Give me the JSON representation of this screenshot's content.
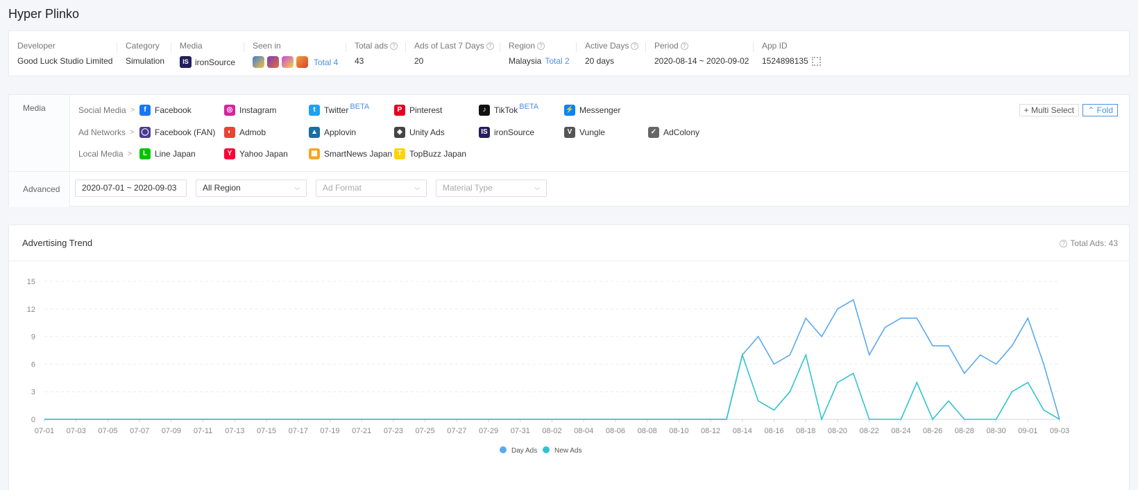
{
  "page": {
    "title": "Hyper Plinko"
  },
  "info": {
    "developer": {
      "label": "Developer",
      "value": "Good Luck Studio Limited"
    },
    "category": {
      "label": "Category",
      "value": "Simulation"
    },
    "media": {
      "label": "Media",
      "value": "ironSource",
      "logo": "IS"
    },
    "seen_in": {
      "label": "Seen in",
      "total": "Total 4",
      "apps": [
        "#3d7bd9",
        "#7b3fb8",
        "#c54bd6",
        "#f0a23a"
      ]
    },
    "total_ads": {
      "label": "Total ads",
      "value": "43"
    },
    "ads_last7": {
      "label": "Ads of Last 7 Days",
      "value": "20"
    },
    "region": {
      "label": "Region",
      "value": "Malaysia",
      "total": "Total 2"
    },
    "active_days": {
      "label": "Active Days",
      "value": "20 days"
    },
    "period": {
      "label": "Period",
      "value": "2020-08-14 ~ 2020-09-02"
    },
    "app_id": {
      "label": "App ID",
      "value": "1524898135"
    }
  },
  "filter": {
    "media_label": "Media",
    "advanced_label": "Advanced",
    "rows": {
      "social": "Social Media",
      "ad_networks": "Ad Networks",
      "local": "Local Media"
    },
    "social_items": [
      {
        "label": "Facebook",
        "icon": "facebook-icon",
        "color": "#1877f2",
        "glyph": "f"
      },
      {
        "label": "Instagram",
        "icon": "instagram-icon",
        "color": "#d6249f",
        "glyph": "◎"
      },
      {
        "label": "Twitter",
        "icon": "twitter-icon",
        "color": "#1da1f2",
        "glyph": "t",
        "badge": "BETA"
      },
      {
        "label": "Pinterest",
        "icon": "pinterest-icon",
        "color": "#e60023",
        "glyph": "P"
      },
      {
        "label": "TikTok",
        "icon": "tiktok-icon",
        "color": "#111111",
        "glyph": "♪",
        "badge": "BETA"
      },
      {
        "label": "Messenger",
        "icon": "messenger-icon",
        "color": "#0084ff",
        "glyph": "⚡"
      }
    ],
    "ad_network_items": [
      {
        "label": "Facebook (FAN)",
        "icon": "facebook-fan-icon",
        "color": "#4b3a8f",
        "glyph": "◯"
      },
      {
        "label": "Admob",
        "icon": "admob-icon",
        "color": "#ea4335",
        "glyph": "◐"
      },
      {
        "label": "Applovin",
        "icon": "applovin-icon",
        "color": "#1a6fa3",
        "glyph": "▲"
      },
      {
        "label": "Unity Ads",
        "icon": "unity-icon",
        "color": "#444444",
        "glyph": "◈"
      },
      {
        "label": "ironSource",
        "icon": "ironsource-icon",
        "color": "#231f5c",
        "glyph": "IS"
      },
      {
        "label": "Vungle",
        "icon": "vungle-icon",
        "color": "#555555",
        "glyph": "V"
      },
      {
        "label": "AdColony",
        "icon": "adcolony-icon",
        "color": "#666666",
        "glyph": "✓"
      }
    ],
    "local_items": [
      {
        "label": "Line Japan",
        "icon": "line-icon",
        "color": "#00c300",
        "glyph": "L"
      },
      {
        "label": "Yahoo Japan",
        "icon": "yahoo-japan-icon",
        "color": "#ff0033",
        "glyph": "Y"
      },
      {
        "label": "SmartNews Japan",
        "icon": "smartnews-icon",
        "color": "#f5a623",
        "glyph": "▦"
      },
      {
        "label": "TopBuzz Japan",
        "icon": "topbuzz-icon",
        "color": "#ffd400",
        "glyph": "T"
      }
    ],
    "multi_select": "Multi Select",
    "fold": "Fold",
    "date_range": "2020-07-01 ~ 2020-09-03",
    "region_select": "All Region",
    "ad_format_placeholder": "Ad Format",
    "material_type_placeholder": "Material Type"
  },
  "trend": {
    "title": "Advertising Trend",
    "total": "Total Ads: 43"
  },
  "chart_data": {
    "type": "line",
    "ylim": [
      0,
      15
    ],
    "yticks": [
      0,
      3,
      6,
      9,
      12,
      15
    ],
    "x": [
      "07-01",
      "07-02",
      "07-03",
      "07-04",
      "07-05",
      "07-06",
      "07-07",
      "07-08",
      "07-09",
      "07-10",
      "07-11",
      "07-12",
      "07-13",
      "07-14",
      "07-15",
      "07-16",
      "07-17",
      "07-18",
      "07-19",
      "07-20",
      "07-21",
      "07-22",
      "07-23",
      "07-24",
      "07-25",
      "07-26",
      "07-27",
      "07-28",
      "07-29",
      "07-30",
      "07-31",
      "08-01",
      "08-02",
      "08-03",
      "08-04",
      "08-05",
      "08-06",
      "08-07",
      "08-08",
      "08-09",
      "08-10",
      "08-11",
      "08-12",
      "08-13",
      "08-14",
      "08-15",
      "08-16",
      "08-17",
      "08-18",
      "08-19",
      "08-20",
      "08-21",
      "08-22",
      "08-23",
      "08-24",
      "08-25",
      "08-26",
      "08-27",
      "08-28",
      "08-29",
      "08-30",
      "08-31",
      "09-01",
      "09-02",
      "09-03"
    ],
    "xtick_labels": [
      "07-01",
      "07-03",
      "07-05",
      "07-07",
      "07-09",
      "07-11",
      "07-13",
      "07-15",
      "07-17",
      "07-19",
      "07-21",
      "07-23",
      "07-25",
      "07-27",
      "07-29",
      "07-31",
      "08-02",
      "08-04",
      "08-06",
      "08-08",
      "08-10",
      "08-12",
      "08-14",
      "08-16",
      "08-18",
      "08-20",
      "08-22",
      "08-24",
      "08-26",
      "08-28",
      "08-30",
      "09-01",
      "09-03"
    ],
    "series": [
      {
        "name": "Day Ads",
        "color": "#5aa9f0",
        "values": [
          0,
          0,
          0,
          0,
          0,
          0,
          0,
          0,
          0,
          0,
          0,
          0,
          0,
          0,
          0,
          0,
          0,
          0,
          0,
          0,
          0,
          0,
          0,
          0,
          0,
          0,
          0,
          0,
          0,
          0,
          0,
          0,
          0,
          0,
          0,
          0,
          0,
          0,
          0,
          0,
          0,
          0,
          0,
          0,
          7,
          9,
          6,
          7,
          11,
          9,
          12,
          13,
          7,
          10,
          11,
          11,
          8,
          8,
          5,
          7,
          6,
          8,
          11,
          6,
          0
        ]
      },
      {
        "name": "New Ads",
        "color": "#2ec4cf",
        "values": [
          0,
          0,
          0,
          0,
          0,
          0,
          0,
          0,
          0,
          0,
          0,
          0,
          0,
          0,
          0,
          0,
          0,
          0,
          0,
          0,
          0,
          0,
          0,
          0,
          0,
          0,
          0,
          0,
          0,
          0,
          0,
          0,
          0,
          0,
          0,
          0,
          0,
          0,
          0,
          0,
          0,
          0,
          0,
          0,
          7,
          2,
          1,
          3,
          7,
          0,
          4,
          5,
          0,
          0,
          0,
          4,
          0,
          2,
          0,
          0,
          0,
          3,
          4,
          1,
          0
        ]
      }
    ]
  }
}
